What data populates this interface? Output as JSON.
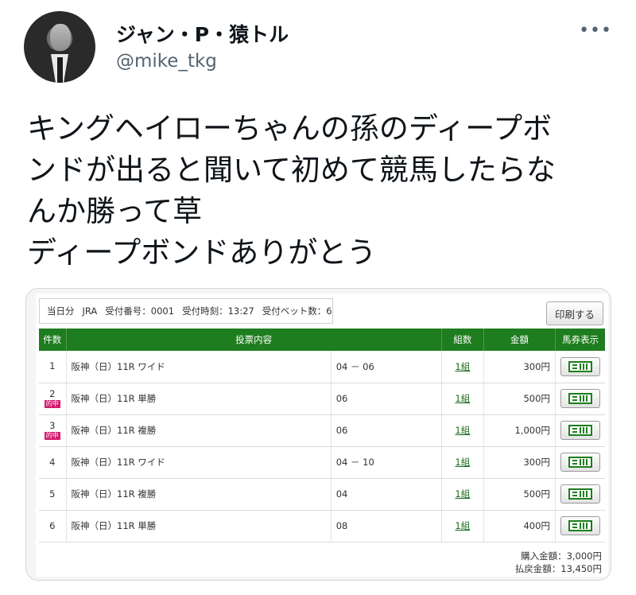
{
  "tweet": {
    "display_name": "ジャン・P・猿トル",
    "handle": "@mike_tkg",
    "more_icon": "more-horizontal-icon",
    "text_lines": [
      "キングヘイローちゃんの孫のディープボ",
      "ンドが出ると聞いて初めて競馬したらな",
      "んか勝って草",
      "ディープボンドありがとう"
    ]
  },
  "receipt": {
    "info": {
      "date": "当日分",
      "org": "JRA",
      "receipt_no": "受付番号：0001",
      "time": "受付時刻：13:27",
      "bet_count": "受付ベット数：6"
    },
    "print_label": "印刷する",
    "columns": [
      "件数",
      "投票内容",
      "組数",
      "金額",
      "馬券表示"
    ],
    "hit_label": "的中",
    "rows": [
      {
        "no": "1",
        "hit": false,
        "content": "阪神（日）11R ワイド",
        "detail": "04 － 06",
        "kumi": "1組",
        "amount": "300円"
      },
      {
        "no": "2",
        "hit": true,
        "content": "阪神（日）11R 単勝",
        "detail": "06",
        "kumi": "1組",
        "amount": "500円"
      },
      {
        "no": "3",
        "hit": true,
        "content": "阪神（日）11R 複勝",
        "detail": "06",
        "kumi": "1組",
        "amount": "1,000円"
      },
      {
        "no": "4",
        "hit": false,
        "content": "阪神（日）11R ワイド",
        "detail": "04 － 10",
        "kumi": "1組",
        "amount": "300円"
      },
      {
        "no": "5",
        "hit": false,
        "content": "阪神（日）11R 複勝",
        "detail": "04",
        "kumi": "1組",
        "amount": "500円"
      },
      {
        "no": "6",
        "hit": false,
        "content": "阪神（日）11R 単勝",
        "detail": "08",
        "kumi": "1組",
        "amount": "400円"
      }
    ],
    "totals": {
      "purchase": "購入金額：3,000円",
      "payout": "払戻金額：13,450円"
    },
    "accent_color": "#1e7d1e",
    "hit_color": "#d21b6e"
  }
}
